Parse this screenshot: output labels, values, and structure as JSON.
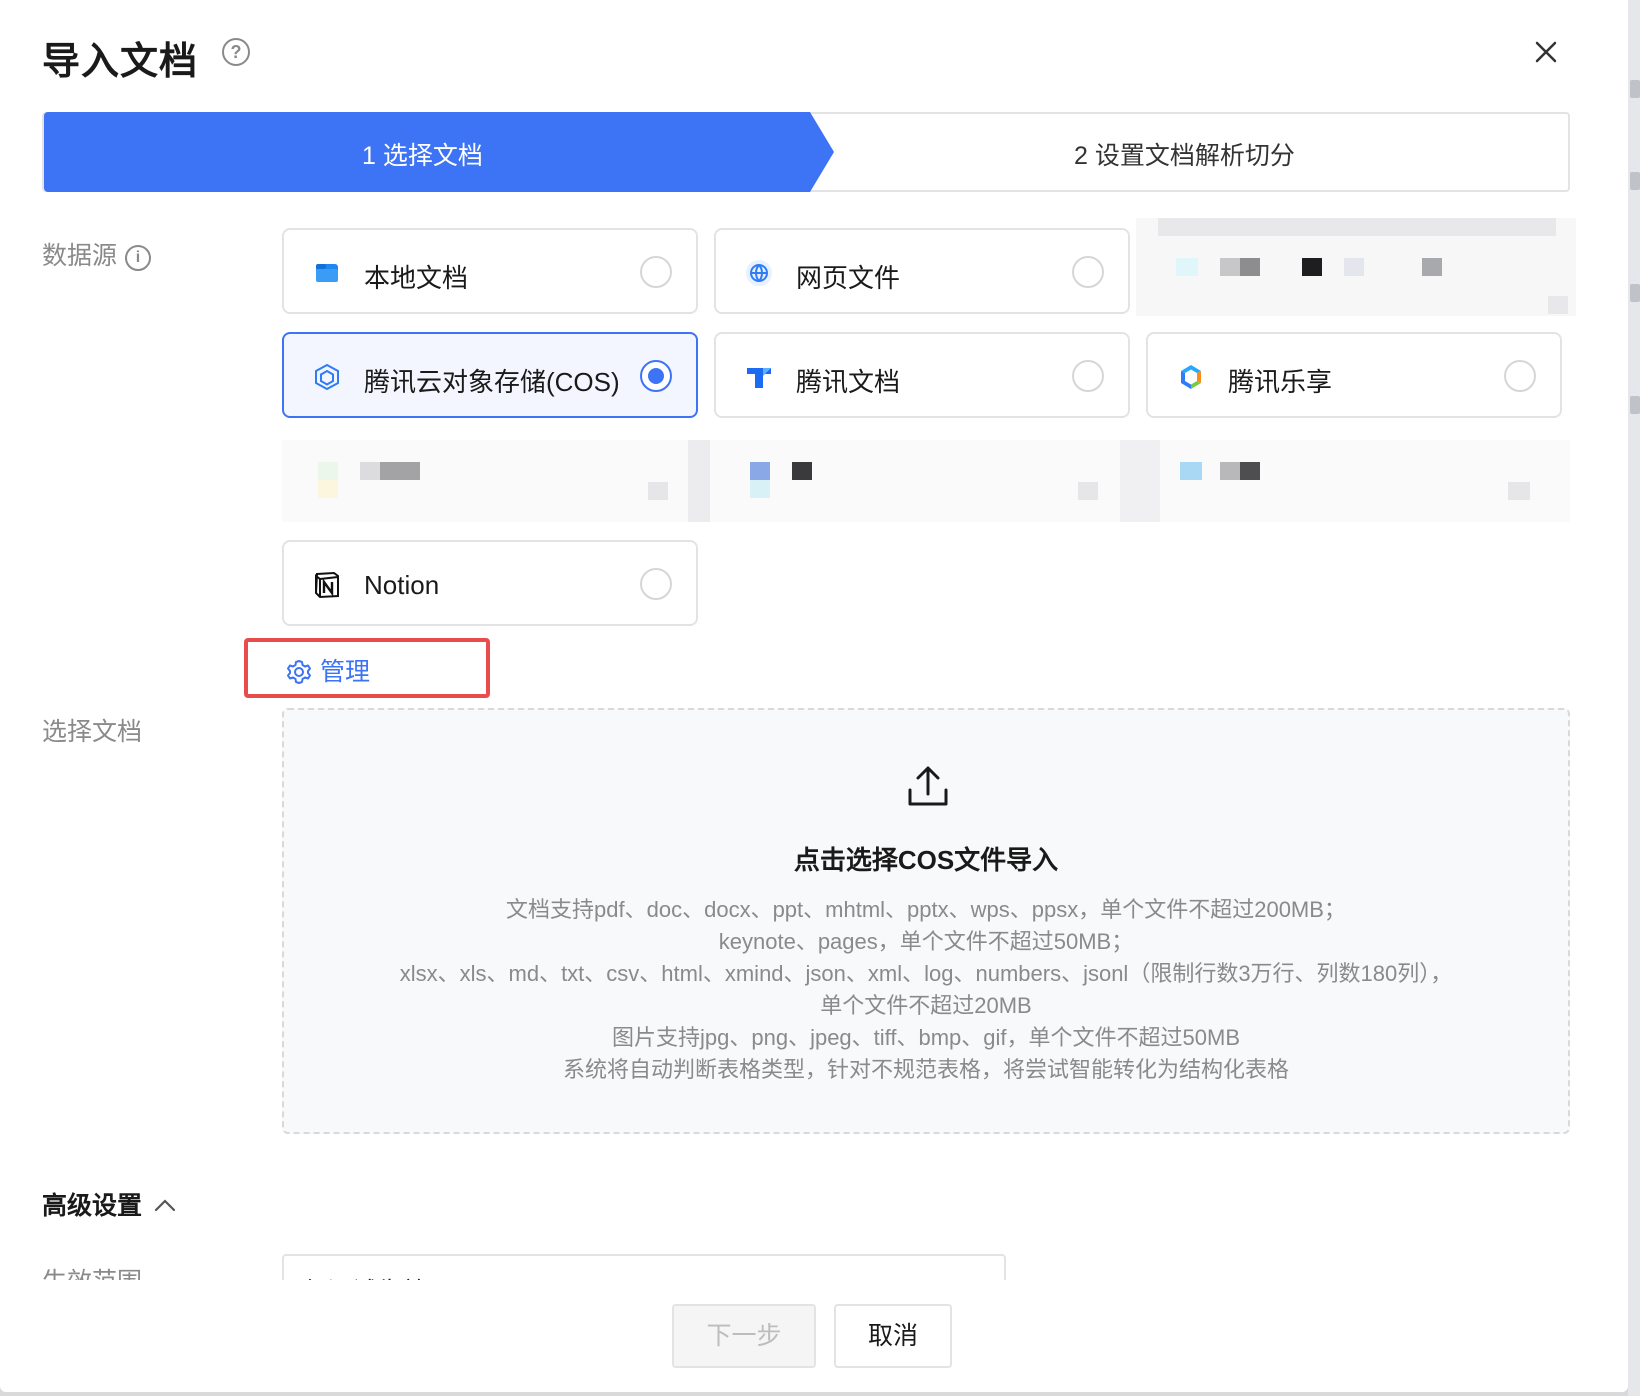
{
  "dialog": {
    "title": "导入文档",
    "close_icon": "close-icon",
    "help_icon": "question-circle-icon"
  },
  "steps": [
    {
      "label": "1 选择文档",
      "active": true
    },
    {
      "label": "2 设置文档解析切分",
      "active": false
    }
  ],
  "data_source": {
    "label": "数据源",
    "info_icon": "info-circle-icon",
    "options": [
      {
        "label": "本地文档",
        "icon": "folder-icon",
        "selected": false
      },
      {
        "label": "网页文件",
        "icon": "globe-icon",
        "selected": false
      },
      {
        "label": "腾讯云对象存储(COS)",
        "icon": "cos-cube-icon",
        "selected": true
      },
      {
        "label": "腾讯文档",
        "icon": "tencent-docs-icon",
        "selected": false
      },
      {
        "label": "腾讯乐享",
        "icon": "tencent-lexiang-icon",
        "selected": false
      },
      {
        "label": "Notion",
        "icon": "notion-icon",
        "selected": false
      }
    ],
    "manage_label": "管理",
    "manage_icon": "gear-icon"
  },
  "select_doc": {
    "label": "选择文档",
    "upload_icon": "upload-icon",
    "upload_title": "点击选择COS文件导入",
    "upload_desc": [
      "文档支持pdf、doc、docx、ppt、mhtml、pptx、wps、ppsx，单个文件不超过200MB；",
      "keynote、pages，单个文件不超过50MB；",
      "xlsx、xls、md、txt、csv、html、xmind、json、xml、log、numbers、jsonl（限制行数3万行、列数180列），",
      "单个文件不超过20MB",
      "图片支持jpg、png、jpeg、tiff、bmp、gif，单个文件不超过50MB",
      "系统将自动判断表格类型，针对不规范表格，将尝试智能转化为结构化表格"
    ]
  },
  "advanced": {
    "label": "高级设置",
    "toggle_icon": "chevron-up-icon",
    "cut_label": "生效范围",
    "cut_value": "仅调试生效"
  },
  "footer": {
    "next_label": "下一步",
    "cancel_label": "取消"
  },
  "colors": {
    "primary": "#3d73f5",
    "highlight_border": "#e84c4c"
  }
}
